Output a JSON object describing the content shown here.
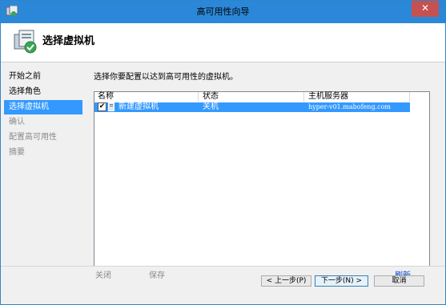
{
  "window": {
    "title": "高可用性向导",
    "close_glyph": "✕"
  },
  "header": {
    "title": "选择虚拟机",
    "icon": "server-cluster-icon"
  },
  "nav": {
    "items": [
      {
        "label": "开始之前",
        "state": "normal"
      },
      {
        "label": "选择角色",
        "state": "normal"
      },
      {
        "label": "选择虚拟机",
        "state": "active"
      },
      {
        "label": "确认",
        "state": "disabled"
      },
      {
        "label": "配置高可用性",
        "state": "disabled"
      },
      {
        "label": "摘要",
        "state": "disabled"
      }
    ]
  },
  "content": {
    "prompt": "选择你要配置以达到高可用性的虚拟机。",
    "columns": [
      "名称",
      "状态",
      "主机服务器"
    ],
    "rows": [
      {
        "checked": true,
        "check_glyph": "✔",
        "name": "新建虚拟机",
        "status": "关机",
        "host": "hyper-v01.mabofeng.com"
      }
    ],
    "actions": {
      "close": "关闭",
      "save": "保存",
      "refresh": "刷新"
    }
  },
  "buttons": {
    "back": "< 上一步(P)",
    "next": "下一步(N) >",
    "cancel": "取消"
  },
  "colors": {
    "titlebar": "#2b88d8",
    "selection": "#3399ff",
    "close": "#c75050"
  }
}
